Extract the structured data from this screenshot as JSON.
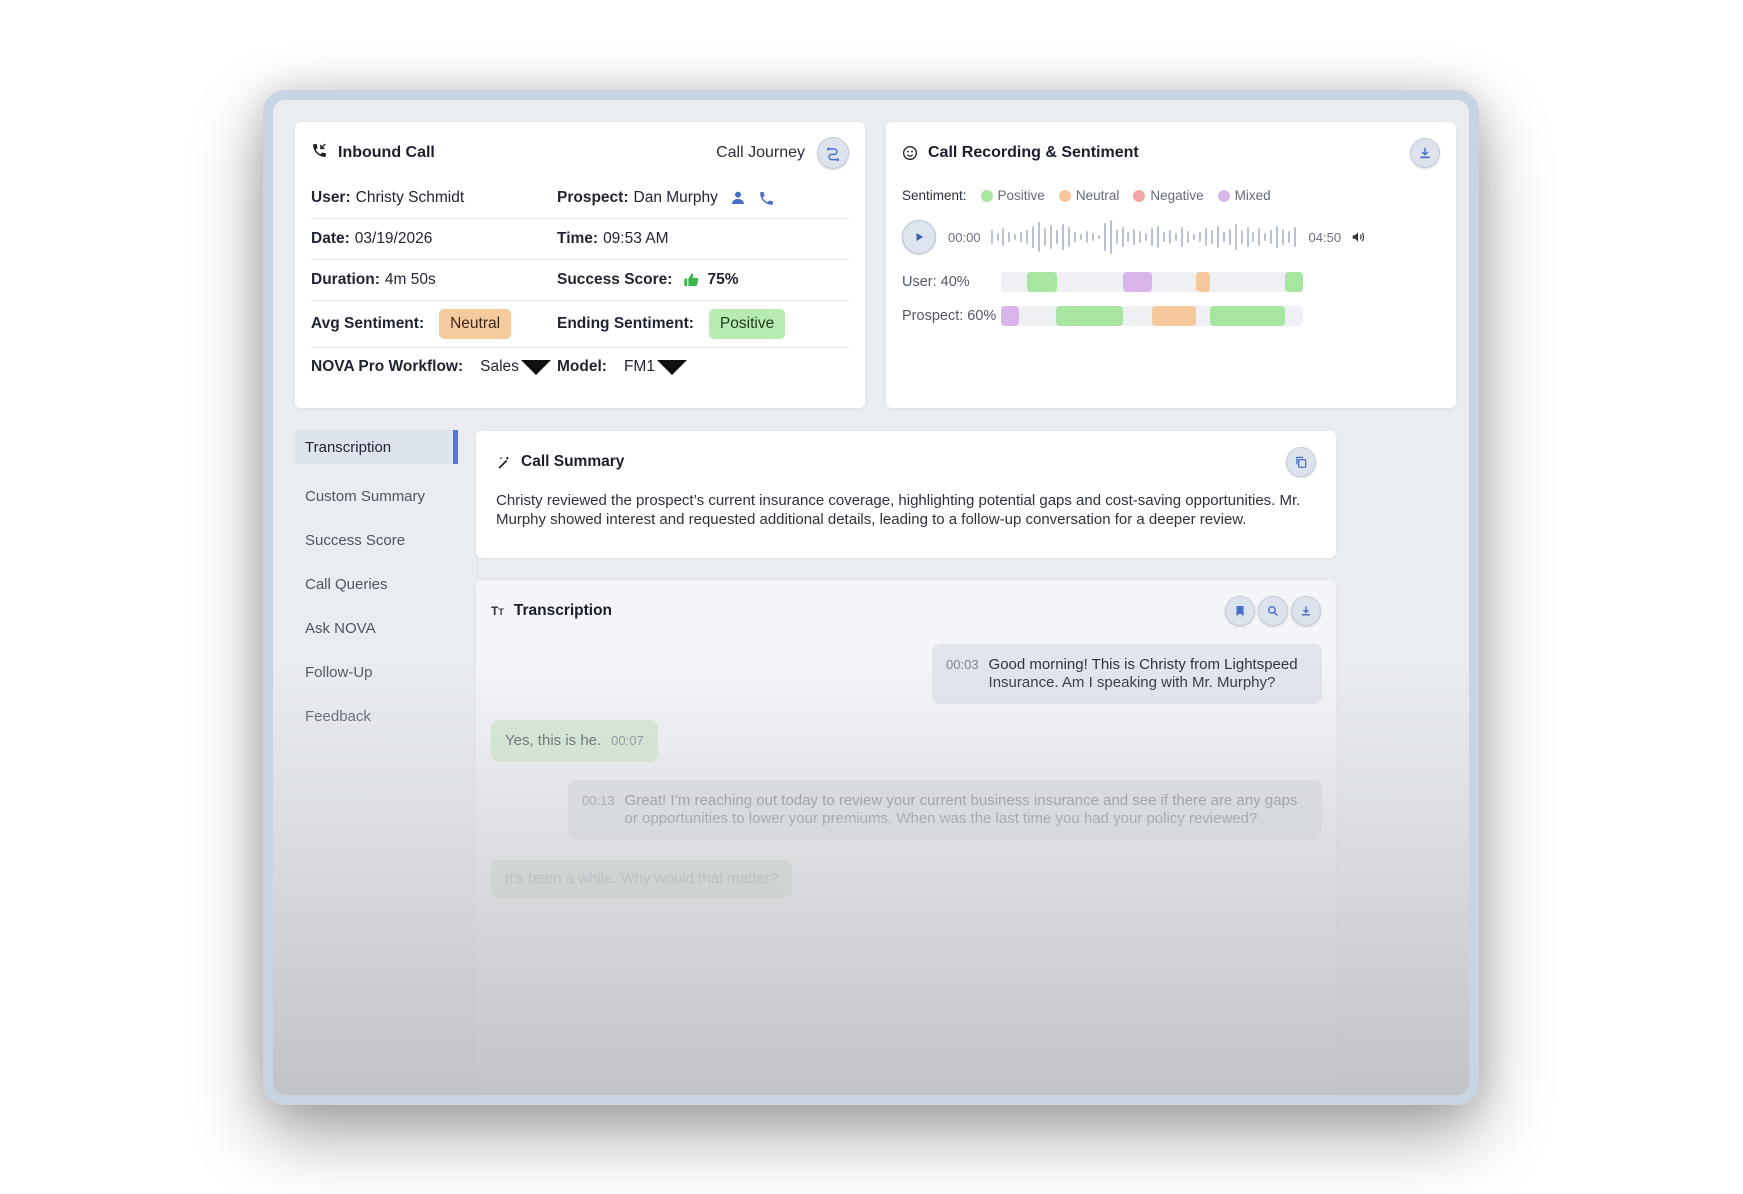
{
  "info_card": {
    "title": "Inbound Call",
    "journey_label": "Call Journey",
    "user_label": "User:",
    "user_value": "Christy Schmidt",
    "prospect_label": "Prospect:",
    "prospect_value": "Dan Murphy",
    "date_label": "Date:",
    "date_value": "03/19/2026",
    "time_label": "Time:",
    "time_value": "09:53 AM",
    "duration_label": "Duration:",
    "duration_value": "4m 50s",
    "success_label": "Success Score:",
    "success_value": "75%",
    "avg_sentiment_label": "Avg Sentiment:",
    "avg_sentiment_value": "Neutral",
    "ending_sentiment_label": "Ending Sentiment:",
    "ending_sentiment_value": "Positive",
    "workflow_label": "NOVA Pro Workflow:",
    "workflow_value": "Sales",
    "model_label": "Model:",
    "model_value": "FM1"
  },
  "recording": {
    "title": "Call Recording & Sentiment",
    "sentiment_label": "Sentiment:",
    "legend": [
      {
        "label": "Positive",
        "color": "#a6e6a0"
      },
      {
        "label": "Neutral",
        "color": "#f7c89b"
      },
      {
        "label": "Negative",
        "color": "#f2a6a6"
      },
      {
        "label": "Mixed",
        "color": "#d9b6ea"
      }
    ],
    "start_time": "00:00",
    "end_time": "04:50",
    "user_row_label": "User: 40%",
    "prospect_row_label": "Prospect: 60%"
  },
  "sidebar": {
    "items": [
      {
        "label": "Transcription"
      },
      {
        "label": "Custom Summary"
      },
      {
        "label": "Success Score"
      },
      {
        "label": "Call Queries"
      },
      {
        "label": "Ask NOVA"
      },
      {
        "label": "Follow-Up"
      },
      {
        "label": "Feedback"
      }
    ]
  },
  "summary": {
    "title": "Call Summary",
    "text": "Christy reviewed the prospect’s current insurance coverage, highlighting potential gaps and cost-saving opportunities. Mr. Murphy showed interest and requested additional details, leading to a follow-up conversation for a deeper review."
  },
  "transcription": {
    "title": "Transcription",
    "messages": [
      {
        "time": "00:03",
        "text": "Good morning! This is Christy from Lightspeed Insurance. Am I speaking with Mr. Murphy?"
      },
      {
        "time": "00:07",
        "text": "Yes, this is he."
      },
      {
        "time": "00:13",
        "text": "Great! I’m reaching out today to review your current business insurance and see if there are any gaps or opportunities to lower your premiums. When was the last time you had your policy reviewed?"
      },
      {
        "time": "",
        "text": "It’s been a while. Why would that matter?"
      }
    ]
  }
}
